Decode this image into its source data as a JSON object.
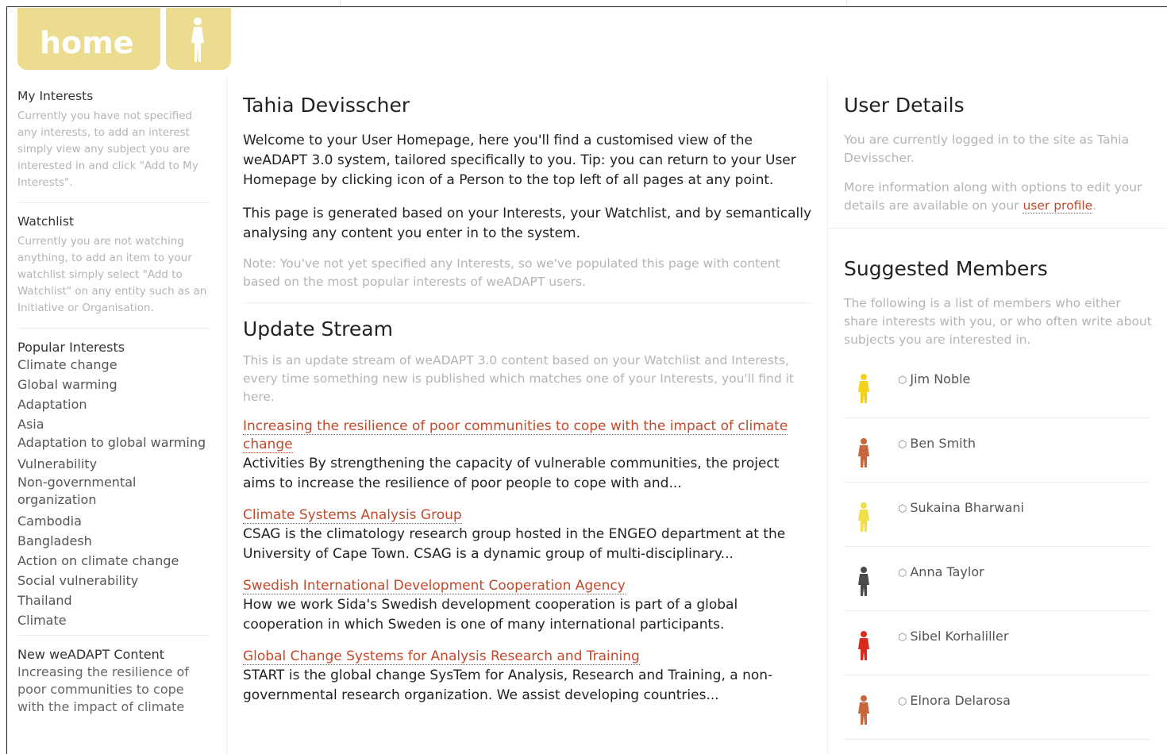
{
  "tabs": {
    "home_label": "home",
    "person_icon": "person-icon"
  },
  "left": {
    "my_interests_title": "My Interests",
    "my_interests_text": "Currently you have not specified any interests, to add an interest simply view any subject you are interested in and click \"Add to My Interests\".",
    "watchlist_title": "Watchlist",
    "watchlist_text": "Currently you are not watching anything, to add an item to your watchlist simply select \"Add to Watchlist\" on any entity such as an Initiative or Organisation.",
    "popular_title": "Popular Interests",
    "popular_items": [
      "Climate change",
      "Global warming",
      "Adaptation",
      "Asia",
      "Adaptation to global warming",
      "Vulnerability",
      "Non-governmental organization",
      "Cambodia",
      "Bangladesh",
      "Action on climate change",
      "Social vulnerability",
      "Thailand",
      "Climate"
    ],
    "new_title": "New weADAPT Content",
    "new_text": "Increasing the resilience of poor communities to cope with the impact of climate"
  },
  "main": {
    "user_name": "Tahia Devisscher",
    "welcome": "Welcome to your User Homepage, here you'll find a customised view of the weADAPT 3.0 system, tailored specifically to you. Tip: you can return to your User Homepage by clicking icon of a Person to the top left of all pages at any point.",
    "generated": "This page is generated based on your Interests, your Watchlist, and by semantically analysing any content you enter in to the system.",
    "note": "Note: You've not yet specified any Interests, so we've populated this page with content based on the most popular interests of weADAPT users.",
    "stream_title": "Update Stream",
    "stream_intro": "This is an update stream of weADAPT 3.0 content based on your Watchlist and Interests, every time something new is published which matches one of your Interests, you'll find it here.",
    "entries": [
      {
        "title": "Increasing the resilience of poor communities to cope with the impact of climate change",
        "desc": "Activities By strengthening the capacity of vulnerable communities, the project aims to increase the resilience of poor people to cope with and..."
      },
      {
        "title": "Climate Systems Analysis Group",
        "desc": "CSAG is the climatology research group hosted in the ENGEO department at the University of Cape Town. CSAG is a dynamic group of multi-disciplinary..."
      },
      {
        "title": "Swedish International Development Cooperation Agency",
        "desc": "How we work Sida's Swedish development cooperation is part of a global cooperation in which Sweden is one of many international participants."
      },
      {
        "title": "Global Change Systems for Analysis Research and Training",
        "desc": "START is the global change SysTem for Analysis, Research and Training, a non-governmental research organization. We assist developing countries..."
      }
    ]
  },
  "right": {
    "details_title": "User Details",
    "logged_in_text": "You are currently logged in to the site as Tahia Devisscher.",
    "more_info_text": "More information along with options to edit your details are available on your",
    "profile_link": "user profile",
    "profile_suffix": ".",
    "suggested_title": "Suggested Members",
    "suggested_intro": "The following is a list of members who either share interests with you, or who often write about subjects you are interested in.",
    "members": [
      {
        "name": "Jim Noble",
        "color": "#f2d21a"
      },
      {
        "name": "Ben Smith",
        "color": "#c8663e"
      },
      {
        "name": "Sukaina Bharwani",
        "color": "#f2de4a"
      },
      {
        "name": "Anna Taylor",
        "color": "#4b4b4b"
      },
      {
        "name": "Sibel Korhaliller",
        "color": "#d92a1e"
      },
      {
        "name": "Elnora Delarosa",
        "color": "#c8663e"
      }
    ]
  }
}
